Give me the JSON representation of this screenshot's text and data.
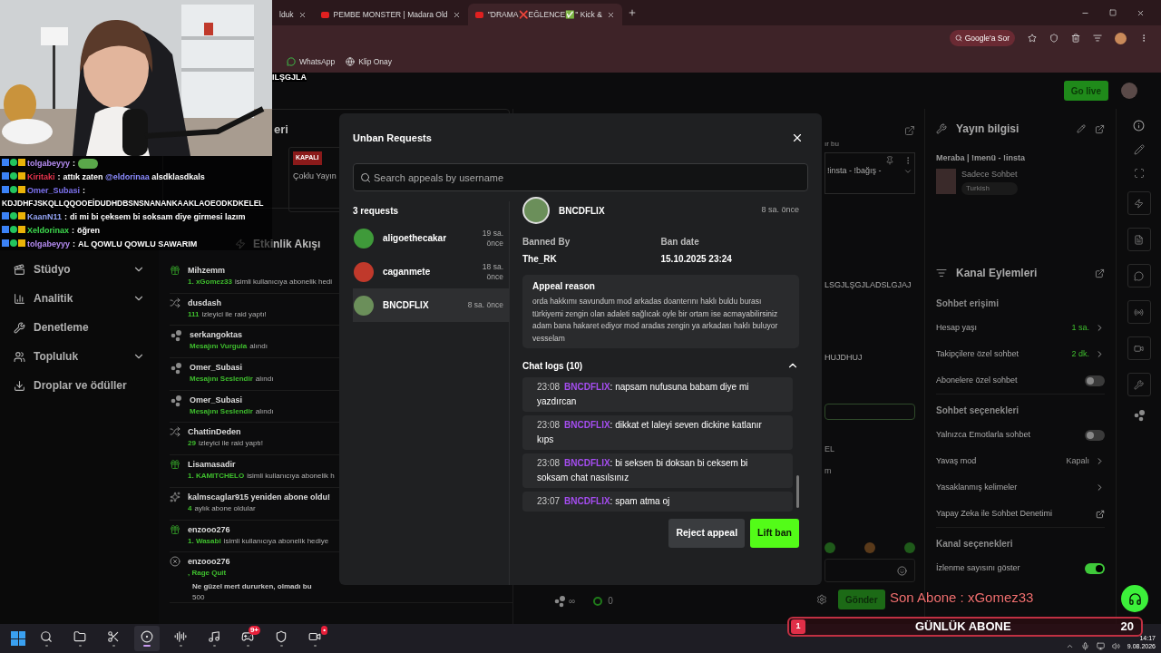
{
  "browser": {
    "tabs": [
      {
        "title": "lduk",
        "selected": false,
        "favicon": false
      },
      {
        "title": "PEMBE MONSTER | Madara Old",
        "selected": false,
        "favicon": true
      },
      {
        "title": "''DRAMA❌EĞLENCE✅'' Kick &",
        "selected": true,
        "favicon": true
      }
    ],
    "ask_button": "Google'a Sor",
    "bookmarks": [
      {
        "label": "WhatsApp",
        "kind": "chat"
      },
      {
        "label": "Klip Onay",
        "kind": "globe"
      }
    ]
  },
  "page": {
    "banner_text": "ILŞGJLA",
    "go_live": "Go live",
    "sidebar": [
      {
        "label": "Stüdyo",
        "kind": "studio",
        "has_submenu": true
      },
      {
        "label": "Analitik",
        "kind": "chart",
        "has_submenu": true
      },
      {
        "label": "Denetleme",
        "kind": "wrench",
        "has_submenu": false
      },
      {
        "label": "Topluluk",
        "kind": "users",
        "has_submenu": true
      },
      {
        "label": "Droplar ve ödüller",
        "kind": "drops",
        "has_submenu": false
      }
    ],
    "status_panel": {
      "title": "eri",
      "cards": [
        {
          "badge": "KAPALI",
          "label": "Çoklu Yayın",
          "color": "#8a1a1a"
        }
      ]
    },
    "activity": {
      "title": "Etkinlik Akışı",
      "events": [
        {
          "kind": "gift",
          "name": "Mihzemm",
          "highlight": "1. xGomez33",
          "detail": "isimli kullanıcıya abonelik hedi"
        },
        {
          "kind": "raid",
          "name": "dusdash",
          "highlight": "111",
          "detail": "izleyici ile raid yaptı!"
        },
        {
          "kind": "reward",
          "name": "serkangoktas",
          "highlight": "Mesajını Vurgula",
          "detail": "alındı"
        },
        {
          "kind": "reward",
          "name": "Omer_Subasi",
          "highlight": "Mesajını Seslendir",
          "detail": "alındı"
        },
        {
          "kind": "reward",
          "name": "Omer_Subasi",
          "highlight": "Mesajını Seslendir",
          "detail": "alındı"
        },
        {
          "kind": "raid",
          "name": "ChattinDeden",
          "highlight": "29",
          "detail": "izleyici ile raid yaptı!"
        },
        {
          "kind": "gift",
          "name": "Lisamasadir",
          "highlight": "1. KAMITCHELO",
          "detail": "isimli kullanıcıya abonelik h"
        },
        {
          "kind": "resub",
          "name": "kalmscaglar915 yeniden abone oldu!",
          "highlight": "4",
          "detail": "aylık abone oldular"
        },
        {
          "kind": "gift",
          "name": "enzooo276",
          "highlight": "1. Wasabi",
          "detail": "isimli kullanıcıya abonelik hediye"
        },
        {
          "kind": "rage",
          "name": "enzooo276",
          "highlight": ", Rage Quit",
          "message": "Ne güzel mert dururken, olmadı bu",
          "amount": "500"
        }
      ]
    },
    "chat": {
      "top_text": "ır bu",
      "pinned": "!insta - !bağış -",
      "messages": [
        "LSGJLŞGJLADSLGJAJ",
        "HUJDHUJ",
        "EL",
        "m"
      ],
      "watchers": "∞",
      "points": "0",
      "send": "Gönder"
    },
    "stream_info": {
      "title": "Yayın bilgisi",
      "stream_title": "Meraba | !menü - !insta",
      "category": "Sadece Sohbet",
      "tag": "Turkish"
    },
    "channel_actions": {
      "title": "Kanal Eylemleri",
      "sections": [
        {
          "title": "Sohbet erişimi",
          "rows": [
            {
              "kind": "value",
              "label": "Hesap yaşı",
              "value": "1 sa.",
              "active": true
            },
            {
              "kind": "value",
              "label": "Takipçilere özel sohbet",
              "value": "2 dk.",
              "active": true
            },
            {
              "kind": "toggle",
              "label": "Abonelere özel sohbet",
              "on": false
            }
          ]
        },
        {
          "title": "Sohbet seçenekleri",
          "rows": [
            {
              "kind": "toggle",
              "label": "Yalnızca Emotlarla sohbet",
              "on": false
            },
            {
              "kind": "value",
              "label": "Yavaş mod",
              "value": "Kapalı",
              "active": false
            },
            {
              "kind": "link",
              "label": "Yasaklanmış kelimeler"
            },
            {
              "kind": "external",
              "label": "Yapay Zeka ile Sohbet Denetimi"
            }
          ]
        },
        {
          "title": "Kanal seçenekleri",
          "rows": [
            {
              "kind": "toggle",
              "label": "İzlenme sayısını göster",
              "on": true
            }
          ]
        }
      ]
    }
  },
  "modal": {
    "title": "Unban Requests",
    "search_placeholder": "Search appeals by username",
    "count": "3 requests",
    "requests": [
      {
        "user": "aligoethecakar",
        "time": "19 sa. önce",
        "selected": false,
        "color": "#3f9a3a"
      },
      {
        "user": "caganmete",
        "time": "18 sa. önce",
        "selected": false,
        "color": "#c0392b"
      },
      {
        "user": "BNCDFLIX",
        "time": "8 sa. önce",
        "selected": true,
        "color": "#6b8f5a"
      }
    ],
    "detail": {
      "user": "BNCDFLIX",
      "time": "8 sa. önce",
      "banned_by_label": "Banned By",
      "banned_by": "The_RK",
      "ban_date_label": "Ban date",
      "ban_date": "15.10.2025 23:24",
      "reason_label": "Appeal reason",
      "reason": "orda hakkımı savundum mod arkadas doanterını haklı buldu burası türkiyemi zengin olan adaleti sağlıcak oyle bir ortam ise acmayabilirsiniz adam bana hakaret ediyor mod aradas zengin ya arkadası haklı buluyor vesselam",
      "logs_label": "Chat logs (10)",
      "logs_expanded": true,
      "logs": [
        {
          "time": "23:08",
          "user": "BNCDFLIX",
          "text": ": napsam nufusuna babam diye mi yazdırcan"
        },
        {
          "time": "23:08",
          "user": "BNCDFLIX",
          "text": ": dikkat et laleyi seven dickine katlanır kıps"
        },
        {
          "time": "23:08",
          "user": "BNCDFLIX",
          "text": ": bi seksen bi doksan bi ceksem bi soksam chat nasılsınız"
        },
        {
          "time": "23:07",
          "user": "BNCDFLIX",
          "text": ": spam atma oj"
        }
      ]
    },
    "buttons": [
      {
        "label": "Reject appeal",
        "kind": "secondary"
      },
      {
        "label": "Lift ban",
        "kind": "primary"
      }
    ]
  },
  "chat_overlay": [
    {
      "user": "tolgabeyyy",
      "color": "#b58cf2",
      "separator": ":",
      "emote": true
    },
    {
      "kind": "inline",
      "user": "Kiritaki",
      "color": "#e8344e",
      "separator": ":",
      "text": "attık zaten **@eldorinaa** alsdklasdkals",
      "emote": false
    },
    {
      "kind": "wrapped",
      "user": "Omer_Subasi",
      "color": "#7f74f2",
      "separator": ":",
      "text": "KDJDHFJSKQLLQQOOEİDUDHDBSNSNANANKAAKLAOEODKDKELEL",
      "emote": false
    },
    {
      "kind": "inline",
      "user": "KaanN11",
      "color": "#94a4f4",
      "separator": ":",
      "text": "di mi bi çeksem bi soksam diye girmesi lazım",
      "emote": false
    },
    {
      "kind": "inline",
      "user": "Xeldorinax",
      "color": "#3ed94e",
      "separator": ":",
      "text": "öğren",
      "emote": false
    },
    {
      "kind": "inline",
      "user": "tolgabeyyy",
      "color": "#b58cf2",
      "separator": ":",
      "text": "AL QOWLU QOWLU SAWARIM",
      "emote": false
    }
  ],
  "last_sub": "Son Abone : xGomez33",
  "daily_goal": {
    "count": "1",
    "label": "GÜNLÜK ABONE",
    "target": "20"
  },
  "taskbar": {
    "apps": [
      {
        "kind": "search",
        "selected": false
      },
      {
        "kind": "folder",
        "selected": false
      },
      {
        "kind": "snip",
        "selected": false
      },
      {
        "kind": "browser",
        "selected": true
      },
      {
        "kind": "audio",
        "selected": false
      },
      {
        "kind": "music",
        "selected": false
      },
      {
        "kind": "discord",
        "selected": false,
        "badge": "9+"
      },
      {
        "kind": "red",
        "selected": false
      },
      {
        "kind": "obs",
        "selected": false,
        "badge": "•"
      }
    ],
    "time": "14:17",
    "date": "9.08.2026"
  }
}
